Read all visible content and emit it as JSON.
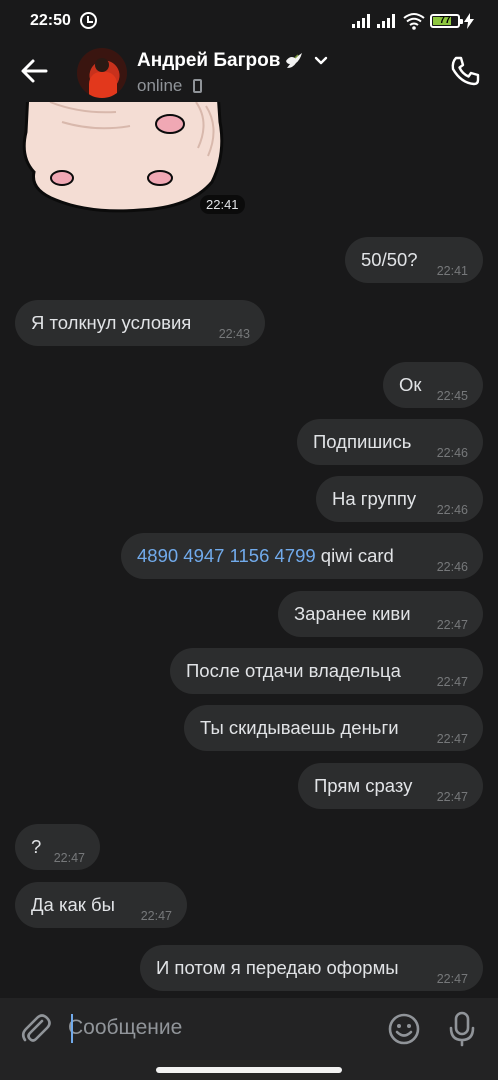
{
  "status_bar": {
    "time": "22:50",
    "battery_level": "77",
    "icons": [
      "alarm-icon",
      "signal-icon",
      "signal-icon",
      "wifi-icon",
      "battery-icon",
      "charging-icon"
    ]
  },
  "header": {
    "contact_name": "Андрей Багров",
    "name_emoji": "dove-icon",
    "status": "online"
  },
  "sticker": {
    "time": "22:41"
  },
  "messages": [
    {
      "direction": "out",
      "text": "50/50?",
      "time": "22:41"
    },
    {
      "direction": "in",
      "text": "Я толкнул условия",
      "time": "22:43"
    },
    {
      "direction": "out",
      "text": "Ок",
      "time": "22:45"
    },
    {
      "direction": "out",
      "text": "Подпишись",
      "time": "22:46"
    },
    {
      "direction": "out",
      "text": "На группу",
      "time": "22:46"
    },
    {
      "direction": "out",
      "link": "4890 4947 1156 4799",
      "text": " qiwi card",
      "time": "22:46"
    },
    {
      "direction": "out",
      "text": "Заранее киви",
      "time": "22:47"
    },
    {
      "direction": "out",
      "text": "После отдачи владельца",
      "time": "22:47"
    },
    {
      "direction": "out",
      "text": "Ты скидываешь деньги",
      "time": "22:47"
    },
    {
      "direction": "out",
      "text": "Прям сразу",
      "time": "22:47"
    },
    {
      "direction": "in",
      "text": "?",
      "time": "22:47"
    },
    {
      "direction": "in",
      "text": "Да как бы",
      "time": "22:47"
    },
    {
      "direction": "out",
      "text": "И потом я передаю оформы",
      "time": "22:47"
    }
  ],
  "composer": {
    "placeholder": "Сообщение"
  },
  "colors": {
    "background": "#19191a",
    "bubble": "#2c2d2e",
    "link": "#71aaeb",
    "battery": "#8dc63f"
  }
}
